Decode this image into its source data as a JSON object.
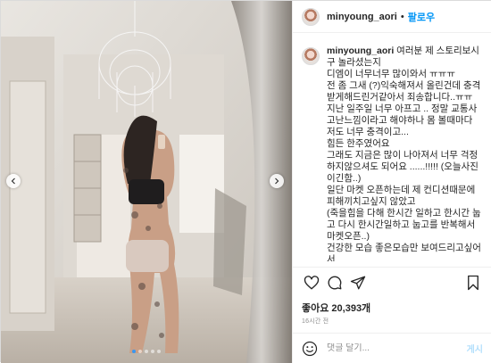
{
  "post": {
    "username": "minyoung_aori",
    "separator": "•",
    "follow_label": "팔로우",
    "caption_text": " 여러분 제 스토리보시구 놀라셨는지\n디엠이 너무너무 많이와서 ㅠㅠㅠ\n전 좀 그새 (?)익숙해져서 올린건데 충격받게해드린거같아서 죄송합니다..ㅠㅠ\n지난 일주일 너무 아프고 .. 정말 교통사고난느낌이라고 해야하나 몸 볼때마다 저도 너무 충격이고...\n힘든 한주였어요\n그래도 지금은 많이 나아져서 너무 걱정하지않으셔도 되어요 ......!!!!! (오늘사진이긴함..)\n일단 마켓 오픈하는데 제 컨디션때문에 피해끼치고싶지 않았고\n(죽을힘을 다해 한시간 일하고 한시간 눕고 다시 한시간일하고 눕고를 반복해서 마켓오픈..)\n건강한 모습 좋은모습만 보여드리고싶어서\n수술후에 했는데",
    "likes_label": "좋아요 20,393개",
    "time_label": "16시간 전",
    "comment_placeholder": "댓글 달기...",
    "post_button": "게시",
    "carousel": {
      "slide_count": 5,
      "active_index": 0
    }
  },
  "icons": {
    "like": "heart-icon",
    "comment": "comment-icon",
    "share": "share-icon",
    "save": "bookmark-icon",
    "emoji": "smiley-icon",
    "prev": "chevron-left-icon",
    "next": "chevron-right-icon"
  },
  "colors": {
    "accent": "#0095f6",
    "dot_active": "#3897f0"
  }
}
